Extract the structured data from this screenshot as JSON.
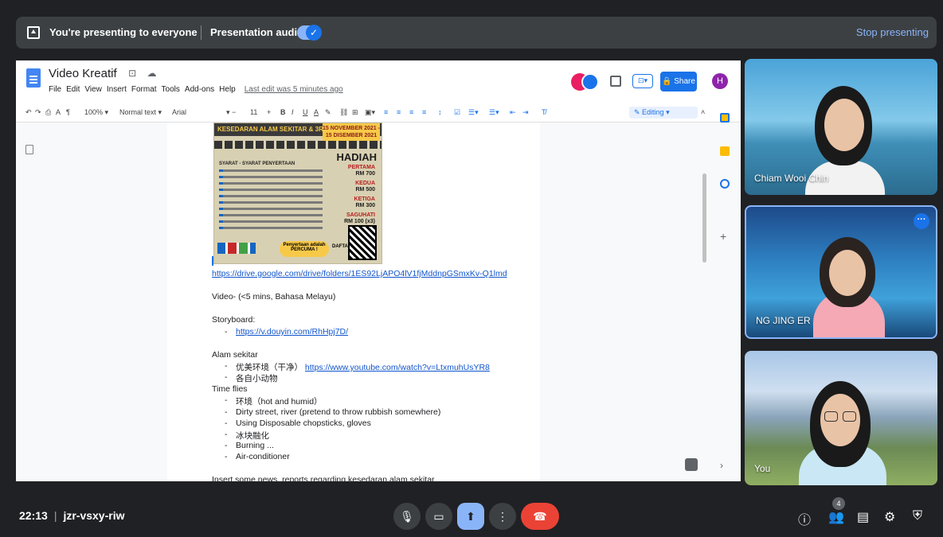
{
  "banner": {
    "presenting_text": "You're presenting to everyone",
    "audio_label": "Presentation audio",
    "audio_enabled": true,
    "stop_label": "Stop presenting"
  },
  "doc": {
    "title": "Video Kreatif",
    "menu": [
      "File",
      "Edit",
      "View",
      "Insert",
      "Format",
      "Tools",
      "Add-ons",
      "Help"
    ],
    "last_edit": "Last edit was 5 minutes ago",
    "share_label": "Share",
    "user_initial": "H",
    "toolbar": {
      "zoom": "100%",
      "style": "Normal text",
      "font": "Arial",
      "font_size": "11",
      "mode": "Editing"
    },
    "poster": {
      "heading": "KESEDARAN ALAM SEKITAR & 3R\"",
      "dates": "15 NOVEMBER 2021 - 15 DISEMBER 2021",
      "prize_title": "HADIAH",
      "prizes": [
        "PERTAMA",
        "RM 700",
        "KEDUA",
        "RM 500",
        "KETIGA",
        "RM 300",
        "SAGUHATI",
        "RM 100 (x3)"
      ],
      "rules_title": "SYARAT - SYARAT PENYERTAAN",
      "free_text": "Penyertaan adalah PERCUMA !",
      "register_text": "DAFTAR DI SINI"
    },
    "body": {
      "link_drive": "https://drive.google.com/drive/folders/1ES92LjAPO4lV1fjMddnpGSmxKv-Q1lmd",
      "video_line": "Video- (<5 mins, Bahasa Melayu)",
      "storyboard_label": "Storyboard:",
      "storyboard_link": "https://v.douyin.com/RhHpj7D/",
      "alam_label": "Alam sekitar",
      "alam_item1_prefix": "优美环境（干净）",
      "alam_item1_link": "https://www.youtube.com/watch?v=LtxmuhUsYR8",
      "alam_item2": "各自小动物",
      "timeflies_label": "Time flies",
      "timeflies_items": [
        "环境（hot and humid）",
        "Dirty street, river (pretend to throw rubbish somewhere)",
        "Using Disposable chopsticks, gloves",
        "冰块融化",
        "Burning ...",
        "Air-conditioner"
      ],
      "cutoff_line": "Insert some news, reports regarding kesedaran alam sekitar"
    }
  },
  "participants": [
    {
      "name": "Chiam Wooi Chin"
    },
    {
      "name": "NG JING ER"
    },
    {
      "name": "You"
    }
  ],
  "bottom": {
    "time": "22:13",
    "meeting_code": "jzr-vsxy-riw",
    "participant_count": "4"
  }
}
